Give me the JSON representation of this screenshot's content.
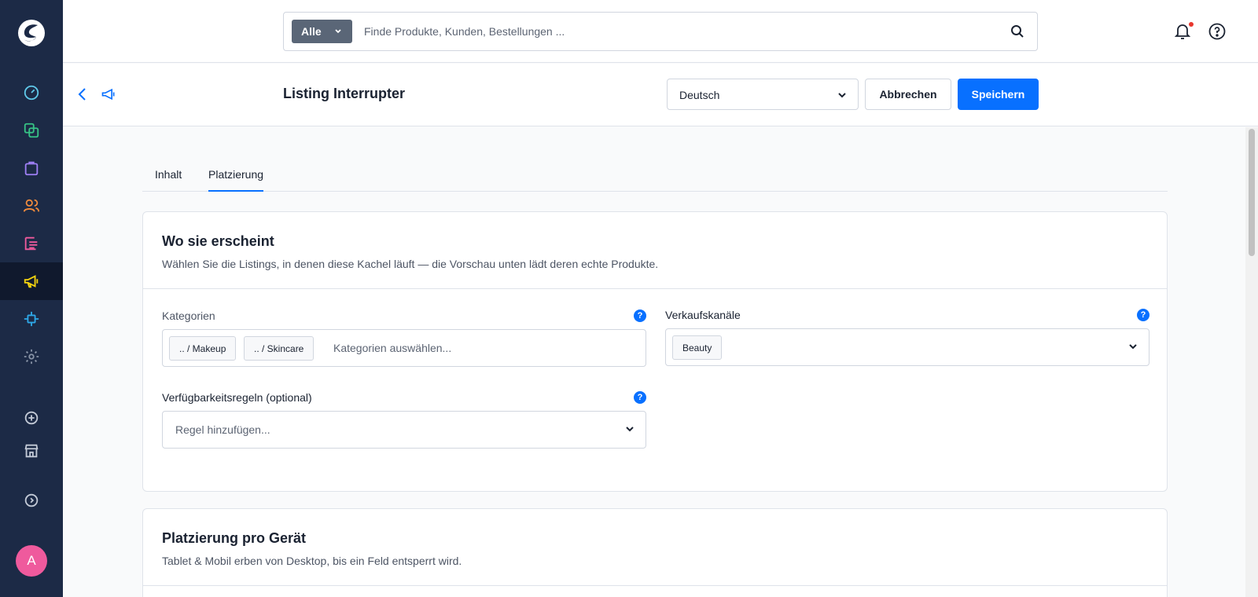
{
  "colors": {
    "sidebar_bg": "#1c2a46",
    "accent": "#0870ff",
    "avatar": "#ef5a9d"
  },
  "sidebar": {
    "items": [
      {
        "icon": "dashboard-icon",
        "color": "#5fc7e8"
      },
      {
        "icon": "catalog-icon",
        "color": "#37c386"
      },
      {
        "icon": "orders-icon",
        "color": "#9e7ff5"
      },
      {
        "icon": "customers-icon",
        "color": "#f08a3c"
      },
      {
        "icon": "content-icon",
        "color": "#ef5a9d"
      },
      {
        "icon": "marketing-icon",
        "color": "#f5d40f",
        "active": true
      },
      {
        "icon": "extensions-icon",
        "color": "#2ea8e8"
      },
      {
        "icon": "settings-icon",
        "color": "#8893a6"
      },
      {
        "icon": "add-icon",
        "color": "#c2c9d6"
      },
      {
        "icon": "store-icon",
        "color": "#c2c9d6"
      },
      {
        "icon": "collapse-icon",
        "color": "#c2c9d6"
      }
    ],
    "avatar_letter": "A"
  },
  "topbar": {
    "search_scope": "Alle",
    "search_placeholder": "Finde Produkte, Kunden, Bestellungen ..."
  },
  "header": {
    "title": "Listing Interrupter",
    "language": "Deutsch",
    "cancel_label": "Abbrechen",
    "save_label": "Speichern"
  },
  "tabs": [
    {
      "label": "Inhalt",
      "active": false
    },
    {
      "label": "Platzierung",
      "active": true
    }
  ],
  "card1": {
    "title": "Wo sie erscheint",
    "subtitle": "Wählen Sie die Listings, in denen diese Kachel läuft — die Vorschau unten lädt deren echte Produkte.",
    "categories": {
      "label": "Kategorien",
      "chips": [
        ".. / Makeup",
        ".. / Skincare"
      ],
      "placeholder": "Kategorien auswählen..."
    },
    "sales_channels": {
      "label": "Verkaufskanäle",
      "chips": [
        "Beauty"
      ]
    },
    "rules": {
      "label": "Verfügbarkeitsregeln (optional)",
      "placeholder": "Regel hinzufügen..."
    },
    "help_glyph": "?"
  },
  "card2": {
    "title": "Platzierung pro Gerät",
    "subtitle": "Tablet & Mobil erben von Desktop, bis ein Feld entsperrt wird."
  }
}
